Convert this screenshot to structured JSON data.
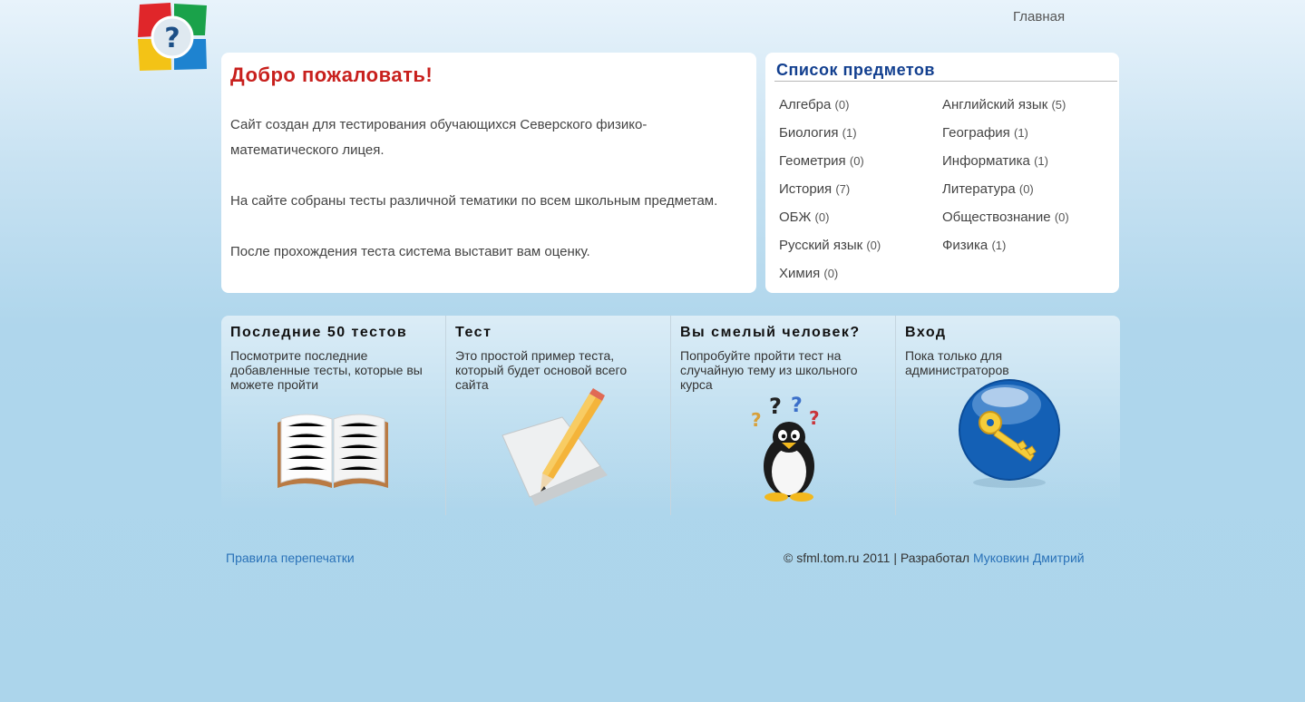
{
  "nav": {
    "home": "Главная"
  },
  "welcome": {
    "title": "Добро пожаловать!",
    "p1": "Сайт создан для тестирования обучающихся Северского физико-математического лицея.",
    "p2": "На сайте собраны тесты различной тематики по всем школьным предметам.",
    "p3": "После прохождения теста система выставит вам оценку."
  },
  "subjects": {
    "title": "Список предметов",
    "items": [
      {
        "name": "Алгебра",
        "count": "(0)"
      },
      {
        "name": "Английский язык",
        "count": "(5)"
      },
      {
        "name": "Биология",
        "count": "(1)"
      },
      {
        "name": "География",
        "count": "(1)"
      },
      {
        "name": "Геометрия",
        "count": "(0)"
      },
      {
        "name": "Информатика",
        "count": "(1)"
      },
      {
        "name": "История",
        "count": "(7)"
      },
      {
        "name": "Литература",
        "count": "(0)"
      },
      {
        "name": "ОБЖ",
        "count": "(0)"
      },
      {
        "name": "Обществознание",
        "count": "(0)"
      },
      {
        "name": "Русский язык",
        "count": "(0)"
      },
      {
        "name": "Физика",
        "count": "(1)"
      },
      {
        "name": "Химия",
        "count": "(0)"
      }
    ]
  },
  "tiles": [
    {
      "title": "Последние 50 тестов",
      "desc": "Посмотрите последние добавленные тесты, которые вы можете пройти",
      "icon": "open-book-icon"
    },
    {
      "title": "Тест",
      "desc": "Это простой пример теста, который будет основой всего сайта",
      "icon": "pencil-paper-icon"
    },
    {
      "title": "Вы смелый человек?",
      "desc": "Попробуйте пройти тест на случайную тему из школьного курса",
      "icon": "penguin-question-icon"
    },
    {
      "title": "Вход",
      "desc": "Пока только для администраторов",
      "icon": "key-orb-icon"
    }
  ],
  "footer": {
    "reprint": "Правила перепечатки",
    "copyright": "© sfml.tom.ru 2011 | Разработал",
    "author": "Муковкин Дмитрий"
  },
  "colors": {
    "title_red": "#c8201d",
    "heading_blue": "#123f8f",
    "link_blue": "#2a72b8"
  }
}
